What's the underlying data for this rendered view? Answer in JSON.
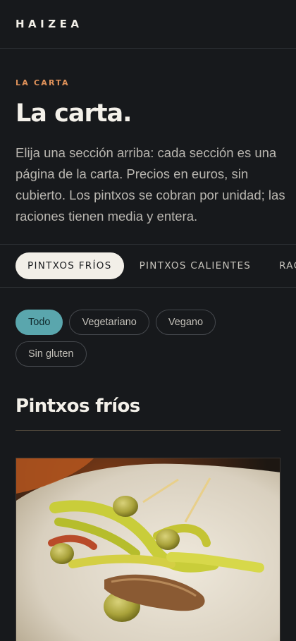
{
  "header": {
    "brand": "HAIZEA"
  },
  "intro": {
    "eyebrow": "LA CARTA",
    "title": "La carta.",
    "lede": "Elija una sección arriba: cada sección es una página de la carta. Precios en euros, sin cubierto. Los pintxos se cobran por unidad; las raciones tienen media y entera."
  },
  "tabs": [
    {
      "label": "PINTXOS FRÍOS",
      "active": true
    },
    {
      "label": "PINTXOS CALIENTES",
      "active": false
    },
    {
      "label": "RACIONES",
      "active": false
    }
  ],
  "filters": [
    {
      "label": "Todo",
      "active": true
    },
    {
      "label": "Vegetariano",
      "active": false
    },
    {
      "label": "Vegano",
      "active": false
    },
    {
      "label": "Sin gluten",
      "active": false
    }
  ],
  "section": {
    "title": "Pintxos fríos"
  },
  "colors": {
    "accent": "#e0925a",
    "filter_active": "#5aa6ad",
    "background": "#17191c"
  }
}
